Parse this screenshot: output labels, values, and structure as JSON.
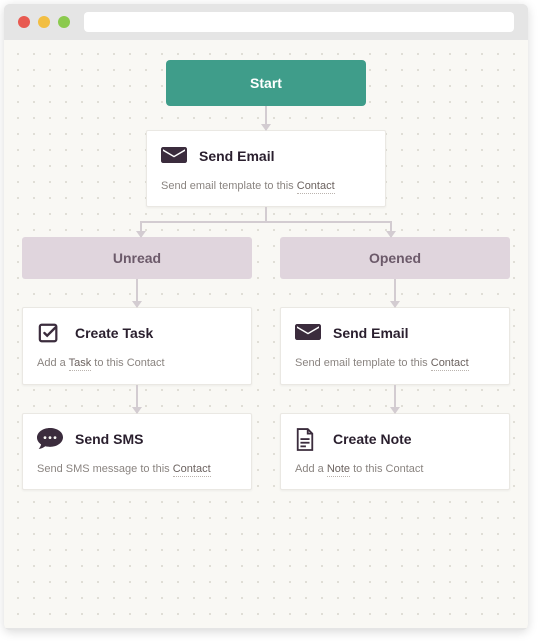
{
  "start": {
    "label": "Start"
  },
  "send_email_top": {
    "title": "Send Email",
    "desc_pre": "Send email template to this ",
    "desc_link": "Contact"
  },
  "branches": {
    "left": {
      "label": "Unread"
    },
    "right": {
      "label": "Opened"
    }
  },
  "left_col": {
    "create_task": {
      "title": "Create Task",
      "desc_pre": "Add a ",
      "desc_link1": "Task",
      "desc_mid": " to this Contact"
    },
    "send_sms": {
      "title": "Send SMS",
      "desc_pre": "Send SMS message to this ",
      "desc_link": "Contact"
    }
  },
  "right_col": {
    "send_email": {
      "title": "Send Email",
      "desc_pre": "Send email template to this ",
      "desc_link": "Contact"
    },
    "create_note": {
      "title": "Create Note",
      "desc_pre": "Add a ",
      "desc_link1": "Note",
      "desc_mid": " to this Contact"
    }
  }
}
